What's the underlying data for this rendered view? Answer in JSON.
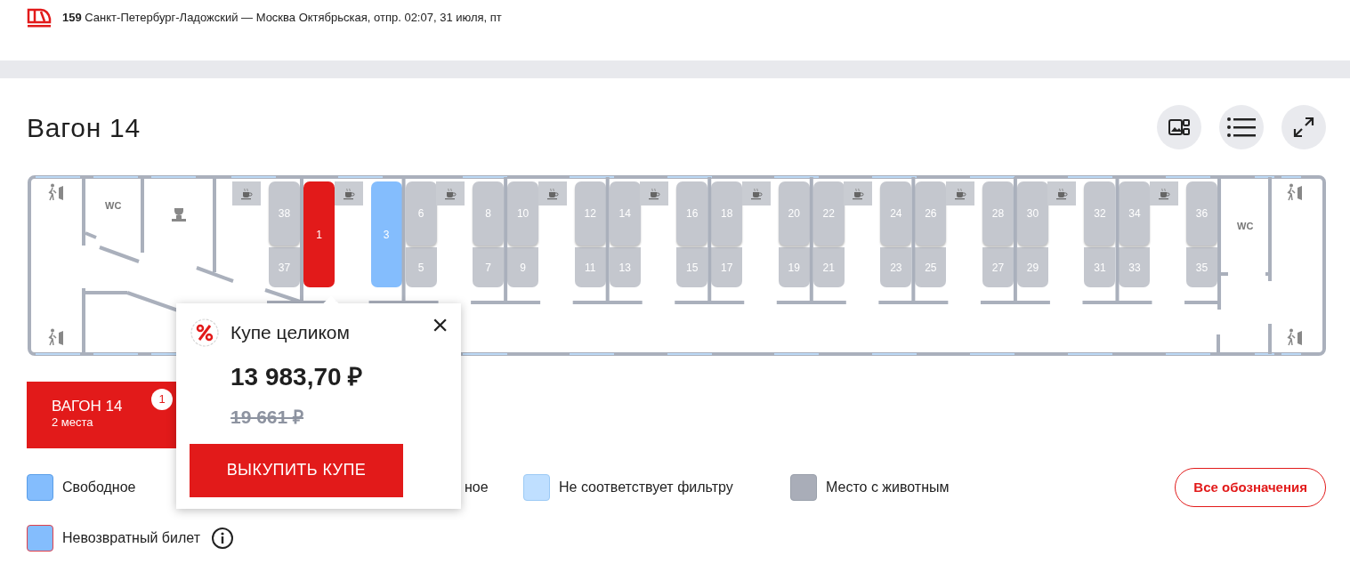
{
  "header": {
    "route": "**159** Санкт-Петербург-Ладожский — Москва Октябрьская, отпр. 02:07, 31 июля, пт"
  },
  "car": {
    "title": "Вагон 14",
    "toilets": [
      "WC",
      "WC"
    ],
    "compartments": [
      {
        "left": [
          {
            "number": "38",
            "available": false,
            "selected": false
          },
          {
            "number": "37",
            "available": false,
            "selected": false
          }
        ],
        "right": [
          {
            "number": "1",
            "available": true,
            "selected": true
          }
        ]
      },
      {
        "left": [
          {
            "number": "3",
            "available": true,
            "selected": false
          }
        ],
        "right": [
          {
            "number": "6",
            "available": false,
            "selected": false
          },
          {
            "number": "5",
            "available": false,
            "selected": false
          }
        ]
      },
      {
        "left": [
          {
            "number": "8",
            "available": false,
            "selected": false
          },
          {
            "number": "7",
            "available": false,
            "selected": false
          }
        ],
        "right": [
          {
            "number": "10",
            "available": false,
            "selected": false
          },
          {
            "number": "9",
            "available": false,
            "selected": false
          }
        ]
      },
      {
        "left": [
          {
            "number": "12",
            "available": false,
            "selected": false
          },
          {
            "number": "11",
            "available": false,
            "selected": false
          }
        ],
        "right": [
          {
            "number": "14",
            "available": false,
            "selected": false
          },
          {
            "number": "13",
            "available": false,
            "selected": false
          }
        ]
      },
      {
        "left": [
          {
            "number": "16",
            "available": false,
            "selected": false
          },
          {
            "number": "15",
            "available": false,
            "selected": false
          }
        ],
        "right": [
          {
            "number": "18",
            "available": false,
            "selected": false
          },
          {
            "number": "17",
            "available": false,
            "selected": false
          }
        ]
      },
      {
        "left": [
          {
            "number": "20",
            "available": false,
            "selected": false
          },
          {
            "number": "19",
            "available": false,
            "selected": false
          }
        ],
        "right": [
          {
            "number": "22",
            "available": false,
            "selected": false
          },
          {
            "number": "21",
            "available": false,
            "selected": false
          }
        ]
      },
      {
        "left": [
          {
            "number": "24",
            "available": false,
            "selected": false
          },
          {
            "number": "23",
            "available": false,
            "selected": false
          }
        ],
        "right": [
          {
            "number": "26",
            "available": false,
            "selected": false
          },
          {
            "number": "25",
            "available": false,
            "selected": false
          }
        ]
      },
      {
        "left": [
          {
            "number": "28",
            "available": false,
            "selected": false
          },
          {
            "number": "27",
            "available": false,
            "selected": false
          }
        ],
        "right": [
          {
            "number": "30",
            "available": false,
            "selected": false
          },
          {
            "number": "29",
            "available": false,
            "selected": false
          }
        ]
      },
      {
        "left": [
          {
            "number": "32",
            "available": false,
            "selected": false
          },
          {
            "number": "31",
            "available": false,
            "selected": false
          }
        ],
        "right": [
          {
            "number": "34",
            "available": false,
            "selected": false
          },
          {
            "number": "33",
            "available": false,
            "selected": false
          }
        ]
      },
      {
        "left": [
          {
            "number": "36",
            "available": false,
            "selected": false
          },
          {
            "number": "35",
            "available": false,
            "selected": false
          }
        ]
      }
    ]
  },
  "popup": {
    "title": "Купе целиком",
    "price": "13 983,70 ₽",
    "old_price": "19 661 ₽",
    "button": "ВЫКУПИТЬ КУПЕ",
    "close": "×"
  },
  "wagon_tab": {
    "label": "ВАГОН 14",
    "seats": "2 места",
    "badge": "1",
    "selected": true
  },
  "legend": [
    {
      "kind": "free",
      "label": "Свободное",
      "color": "#84bdfd"
    },
    {
      "label": "ное"
    },
    {
      "kind": "filtered",
      "label": "Не соответствует фильтру",
      "color": "#bfdfff"
    },
    {
      "kind": "pet",
      "label": "Место с животным",
      "color": "#a9adb8"
    },
    {
      "kind": "nonrefundable",
      "label": "Невозвратный билет",
      "color": "#84bdfd"
    }
  ],
  "legend_button": "Все обозначения"
}
